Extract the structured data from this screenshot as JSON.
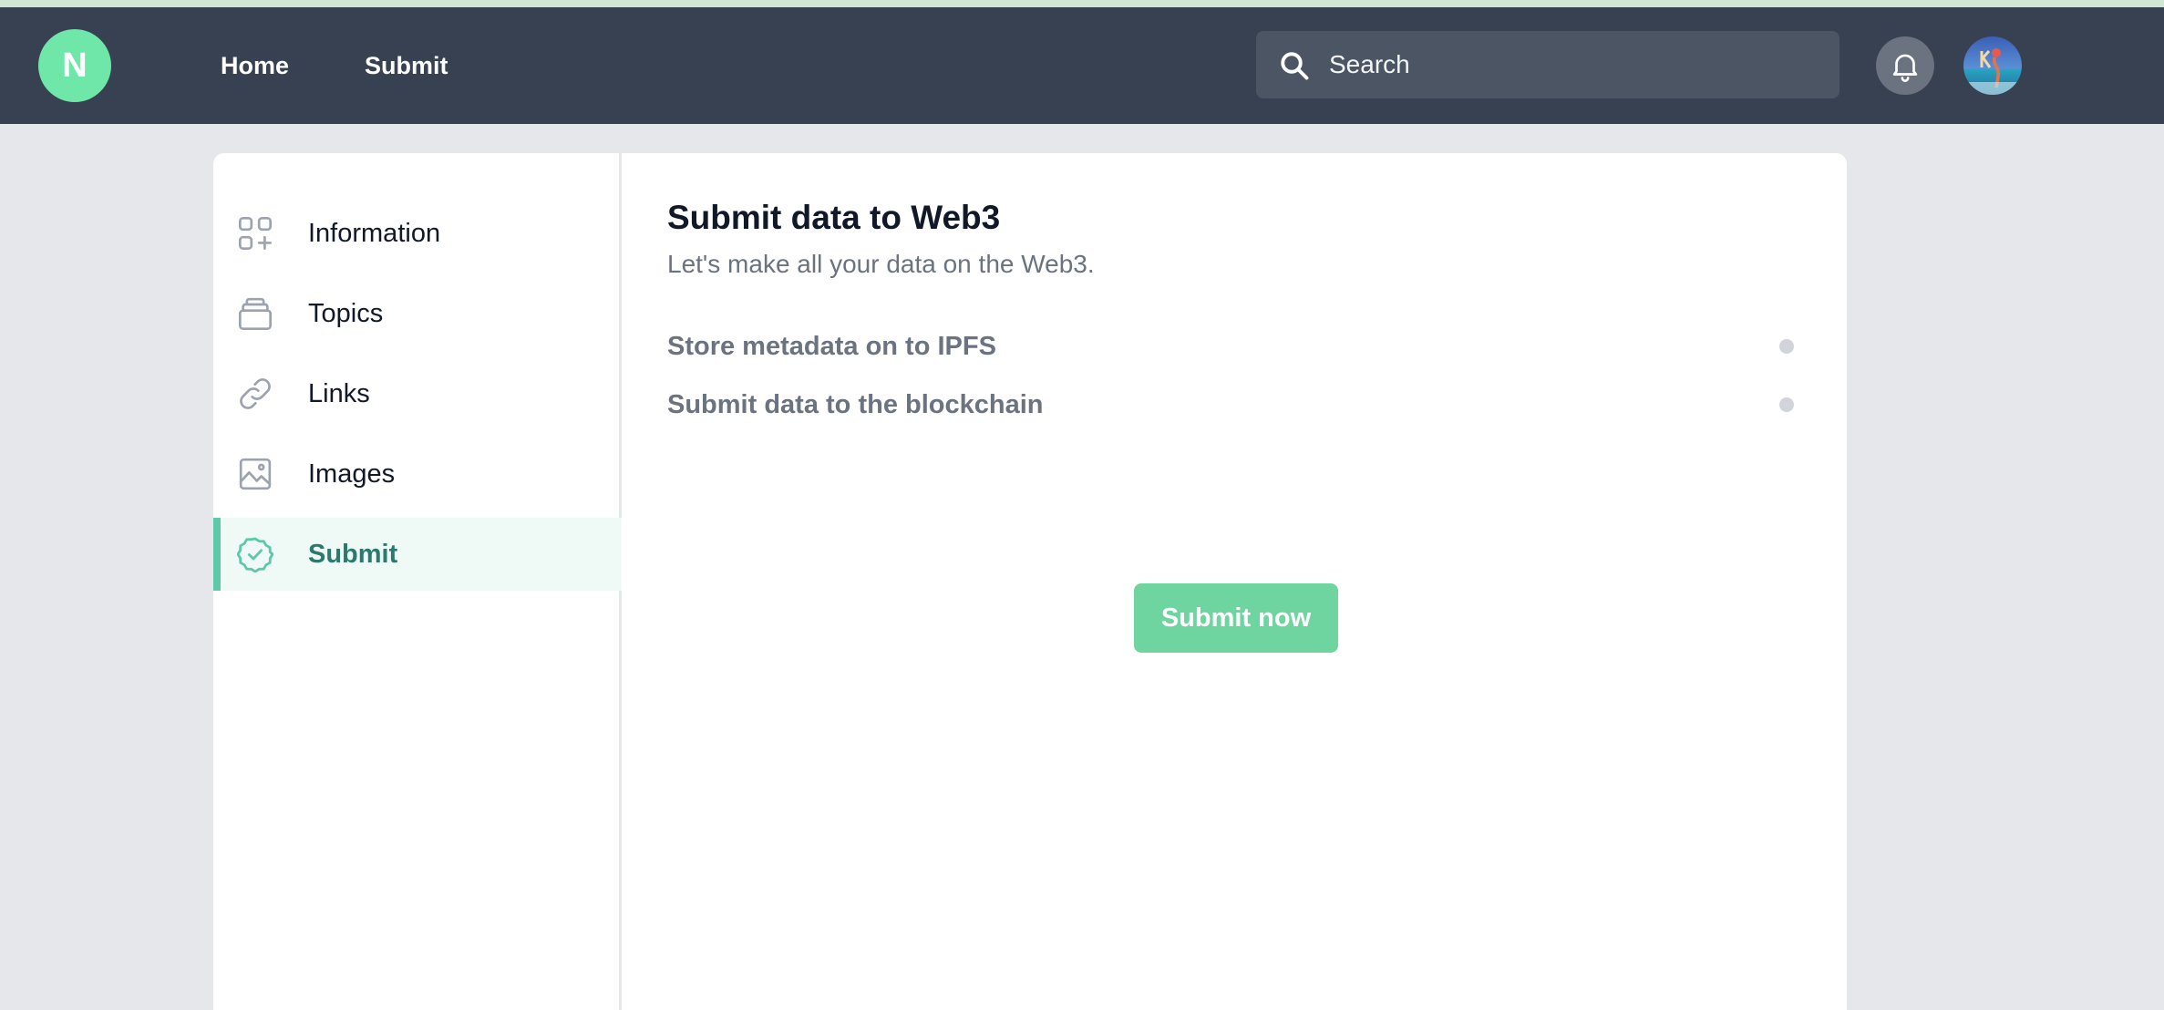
{
  "navbar": {
    "logo_letter": "N",
    "links": [
      {
        "label": "Home"
      },
      {
        "label": "Submit"
      }
    ],
    "search": {
      "placeholder": "Search",
      "value": ""
    },
    "bell_icon": "bell-icon",
    "avatar": "user-avatar"
  },
  "sidebar": {
    "items": [
      {
        "label": "Information",
        "icon": "grid-plus-icon",
        "active": false
      },
      {
        "label": "Topics",
        "icon": "stack-icon",
        "active": false
      },
      {
        "label": "Links",
        "icon": "link-icon",
        "active": false
      },
      {
        "label": "Images",
        "icon": "image-icon",
        "active": false
      },
      {
        "label": "Submit",
        "icon": "badge-check-icon",
        "active": true
      }
    ]
  },
  "main": {
    "title": "Submit data to Web3",
    "subtitle": "Let's make all your data on the Web3.",
    "steps": [
      {
        "label": "Store metadata on to IPFS"
      },
      {
        "label": "Submit data to the blockchain"
      }
    ],
    "submit_label": "Submit now"
  },
  "colors": {
    "navbar_bg": "#374151",
    "accent": "#5ec8a8",
    "button_bg": "#6ed4a0",
    "page_bg": "#e5e7eb"
  }
}
